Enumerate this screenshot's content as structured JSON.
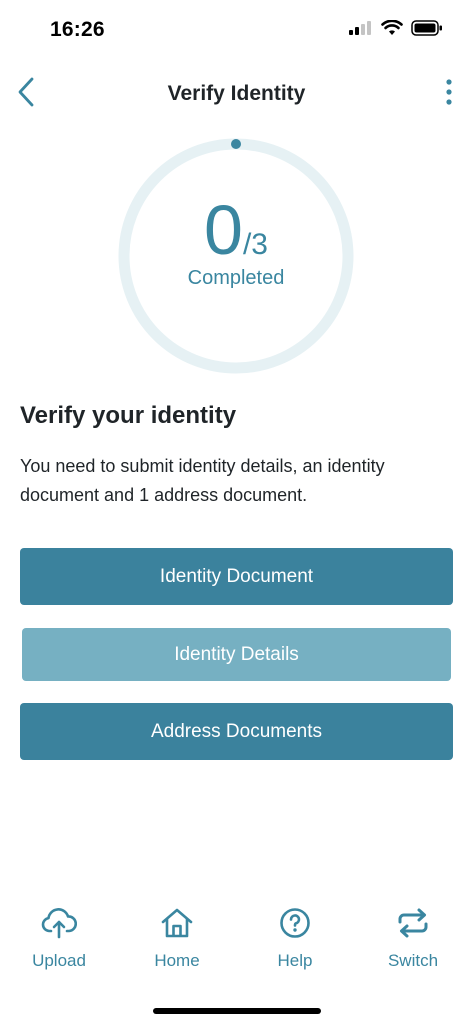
{
  "status_bar": {
    "time": "16:26"
  },
  "nav": {
    "title": "Verify Identity",
    "back_icon": "chevron-left-icon",
    "more_icon": "more-vertical-icon"
  },
  "progress": {
    "completed": "0",
    "total": "/3",
    "label": "Completed",
    "fraction": 0.0
  },
  "section": {
    "heading": "Verify your identity",
    "description": "You need to submit identity details, an identity document and 1 address document."
  },
  "actions": [
    {
      "label": "Identity Document"
    },
    {
      "label": "Identity Details"
    },
    {
      "label": "Address Documents"
    }
  ],
  "tabs": [
    {
      "label": "Upload",
      "icon": "cloud-upload-icon"
    },
    {
      "label": "Home",
      "icon": "home-icon"
    },
    {
      "label": "Help",
      "icon": "help-circle-icon"
    },
    {
      "label": "Switch",
      "icon": "switch-arrows-icon"
    }
  ],
  "colors": {
    "accent": "#3a86a0",
    "button_primary": "#3b829d",
    "button_disabled": "#76b0c2",
    "ring_track": "#e6f1f4"
  }
}
